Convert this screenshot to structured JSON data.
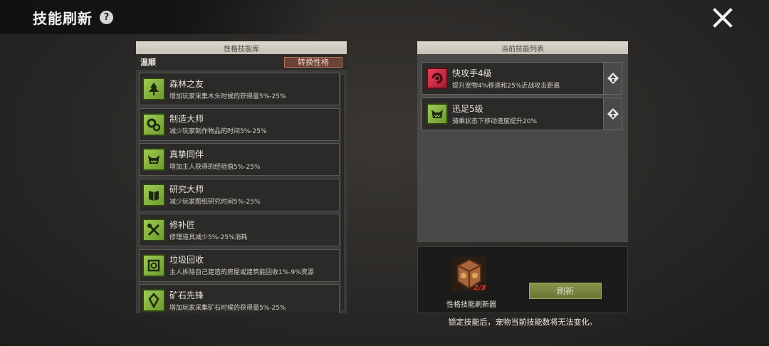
{
  "header": {
    "title": "技能刷新",
    "help_icon": "?"
  },
  "left_panel": {
    "header": "性格技能库",
    "trait": "温顺",
    "switch_label": "转换性格",
    "skills": [
      {
        "name": "森林之友",
        "desc": "增加玩家采集木头时候的获得量5%-25%",
        "icon": "tree-icon"
      },
      {
        "name": "制造大师",
        "desc": "减少玩家制作物品的时间5%-25%",
        "icon": "gears-icon"
      },
      {
        "name": "真挚同伴",
        "desc": "增加主人获得的经验值5%-25%",
        "icon": "monster-face-icon"
      },
      {
        "name": "研究大师",
        "desc": "减少玩家图纸研究时间5%-25%",
        "icon": "book-icon"
      },
      {
        "name": "修补匠",
        "desc": "修理道具减少5%-25%消耗",
        "icon": "tools-icon"
      },
      {
        "name": "垃圾回收",
        "desc": "主人拆除自己建造的房屋或建筑能回收1%-9%资源",
        "icon": "recycle-icon"
      },
      {
        "name": "矿石先锋",
        "desc": "增加玩家采集矿石时候的获得量5%-25%",
        "icon": "crystal-icon"
      }
    ]
  },
  "right_panel": {
    "header": "当前技能列表",
    "skills": [
      {
        "name": "快攻手4级",
        "desc": "提升宠物4%移速和25%近战攻击距离",
        "icon": "swirl-icon",
        "color": "#d8304c"
      },
      {
        "name": "迅足5级",
        "desc": "骑乘状态下移动速度提升20%",
        "icon": "monster-face-icon",
        "color": "#86b43e"
      }
    ]
  },
  "refresh_box": {
    "item_label": "性格技能刷新器",
    "item_count": "2/3",
    "refresh_label": "刷新"
  },
  "footer_note": "锁定技能后，宠物当前技能数将无法变化。"
}
